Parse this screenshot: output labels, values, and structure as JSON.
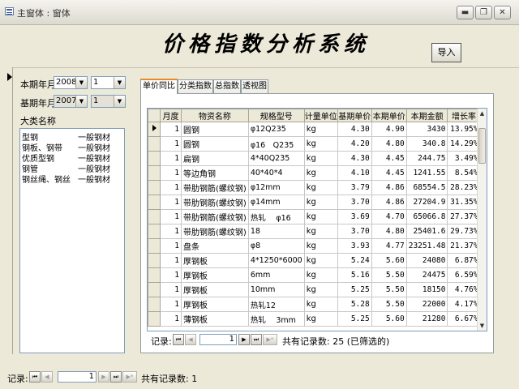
{
  "window": {
    "title": "主窗体 : 窗体",
    "minimize_label": "▬",
    "restore_label": "❐",
    "close_label": "✕"
  },
  "header": {
    "title": "价格指数分析系统",
    "import_label": "导入"
  },
  "filters": {
    "current_label": "本期年月",
    "current_year": "2008",
    "current_month": "1",
    "base_label": "基期年月",
    "base_year": "2007",
    "base_month": "1"
  },
  "categories": {
    "label": "大类名称",
    "items": [
      {
        "name": "型钢",
        "type": "一般钢材"
      },
      {
        "name": "钢板、钢带",
        "type": "一般钢材"
      },
      {
        "name": "优质型钢",
        "type": "一般钢材"
      },
      {
        "name": "钢管",
        "type": "一般钢材"
      },
      {
        "name": "钢丝绳、钢丝",
        "type": "一般钢材"
      }
    ]
  },
  "tabs": [
    {
      "label": "单价同比"
    },
    {
      "label": "分类指数"
    },
    {
      "label": "总指数"
    },
    {
      "label": "透视图"
    }
  ],
  "grid": {
    "columns": [
      "月度",
      "物资名称",
      "规格型号",
      "计量单位",
      "基期单价",
      "本期单价",
      "本期金额",
      "增长率"
    ],
    "rows": [
      [
        "1",
        "圆钢",
        "φ12Q235",
        "kg",
        "4.30",
        "4.90",
        "3430",
        "13.95%"
      ],
      [
        "1",
        "圆钢",
        "φ16　Q235",
        "kg",
        "4.20",
        "4.80",
        "340.8",
        "14.29%"
      ],
      [
        "1",
        "扁钢",
        "4*40Q235",
        "kg",
        "4.30",
        "4.45",
        "244.75",
        "3.49%"
      ],
      [
        "1",
        "等边角钢",
        "40*40*4",
        "kg",
        "4.10",
        "4.45",
        "1241.55",
        "8.54%"
      ],
      [
        "1",
        "带肋钢筋(螺纹钢)",
        "φ12mm",
        "kg",
        "3.79",
        "4.86",
        "68554.5",
        "28.23%"
      ],
      [
        "1",
        "带肋钢筋(螺纹钢)",
        "φ14mm",
        "kg",
        "3.70",
        "4.86",
        "27204.9",
        "31.35%"
      ],
      [
        "1",
        "带肋钢筋(螺纹钢)",
        "热轧　 φ16",
        "kg",
        "3.69",
        "4.70",
        "65066.8",
        "27.37%"
      ],
      [
        "1",
        "带肋钢筋(螺纹钢)",
        "18",
        "kg",
        "3.70",
        "4.80",
        "25401.6",
        "29.73%"
      ],
      [
        "1",
        "盘条",
        "φ8",
        "kg",
        "3.93",
        "4.77",
        "23251.48",
        "21.37%"
      ],
      [
        "1",
        "厚钢板",
        "4*1250*6000",
        "kg",
        "5.24",
        "5.60",
        "24080",
        "6.87%"
      ],
      [
        "1",
        "厚钢板",
        "6mm",
        "kg",
        "5.16",
        "5.50",
        "24475",
        "6.59%"
      ],
      [
        "1",
        "厚钢板",
        "10mm",
        "kg",
        "5.25",
        "5.50",
        "18150",
        "4.76%"
      ],
      [
        "1",
        "厚钢板",
        "热轧12",
        "kg",
        "5.28",
        "5.50",
        "22000",
        "4.17%"
      ],
      [
        "1",
        "薄钢板",
        "热轧　 3mm",
        "kg",
        "5.25",
        "5.60",
        "21280",
        "6.67%"
      ]
    ]
  },
  "grid_nav": {
    "label": "记录:",
    "current": "1",
    "count_text": "共有记录数: 25 (已筛选的)"
  },
  "form_nav": {
    "label": "记录:",
    "current": "1",
    "count_text": "共有记录数: 1"
  },
  "icons": {
    "first": "⏮",
    "prev": "◀",
    "next": "▶",
    "last": "⏭",
    "new": "▶*",
    "dropdown": "▼",
    "up": "▲",
    "down": "▼"
  }
}
